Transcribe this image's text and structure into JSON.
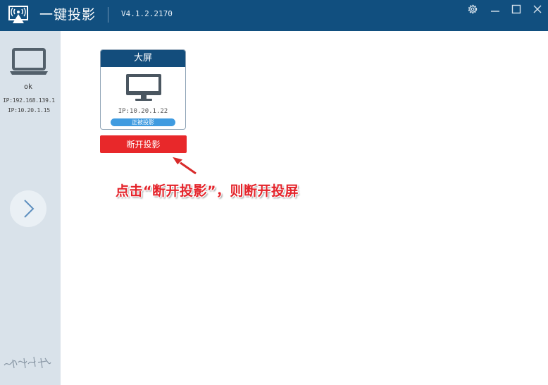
{
  "titlebar": {
    "app_title": "一键投影",
    "version": "V4.1.2.2170",
    "icons": [
      "cast-logo-icon",
      "gear-icon",
      "minimize-icon",
      "maximize-icon",
      "close-icon"
    ]
  },
  "sidebar": {
    "device_name": "ok",
    "ip_lines": [
      "IP:192.168.139.1",
      "IP:10.20.1.15"
    ],
    "icons": [
      "laptop-icon",
      "chevron-right-icon",
      "signature"
    ]
  },
  "card": {
    "title": "大屏",
    "ip": "IP:10.20.1.22",
    "status": "正被投影"
  },
  "disconnect_button": {
    "label": "断开投影"
  },
  "annotation": {
    "text": "点击“断开投影”，则断开投屏"
  },
  "colors": {
    "titlebar": "#114f7f",
    "sidebar": "#d9e2ea",
    "card_header": "#134d7c",
    "status_badge": "#3f9be0",
    "disconnect": "#e8282a",
    "annotation": "#e4242b"
  }
}
